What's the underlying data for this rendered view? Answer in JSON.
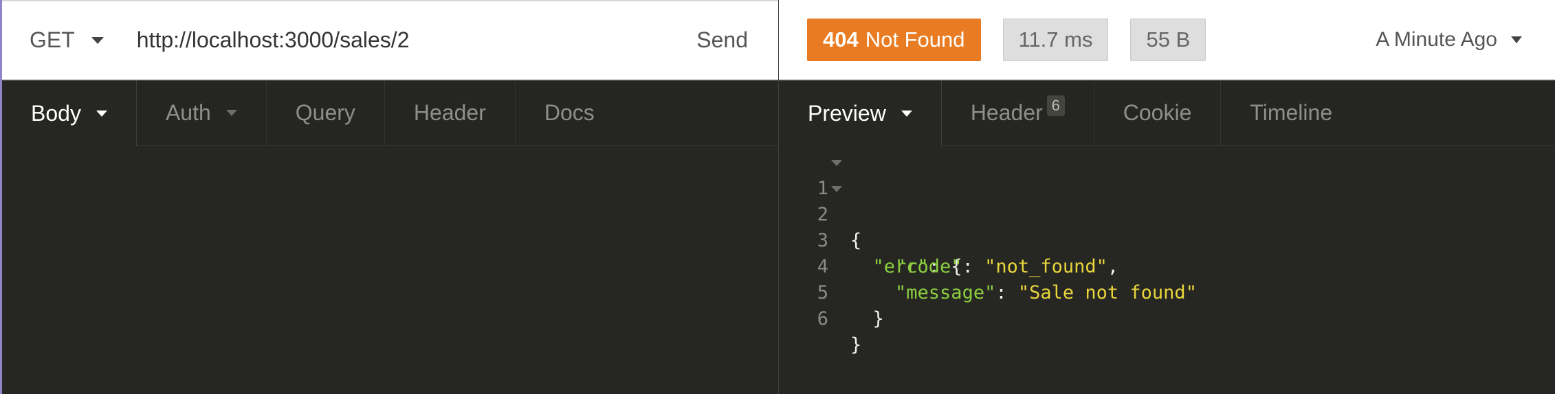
{
  "request": {
    "method": "GET",
    "url": "http://localhost:3000/sales/2",
    "send_label": "Send",
    "tabs": [
      {
        "label": "Body"
      },
      {
        "label": "Auth"
      },
      {
        "label": "Query"
      },
      {
        "label": "Header"
      },
      {
        "label": "Docs"
      }
    ]
  },
  "response": {
    "status_code": "404",
    "status_text": "Not Found",
    "status_color": "#e97c22",
    "time": "11.7 ms",
    "size": "55 B",
    "history_label": "A Minute Ago",
    "tabs": [
      {
        "label": "Preview"
      },
      {
        "label": "Header",
        "count": "6"
      },
      {
        "label": "Cookie"
      },
      {
        "label": "Timeline"
      }
    ],
    "body": {
      "line_numbers": [
        "1",
        "2",
        "3",
        "4",
        "5",
        "6"
      ],
      "open_brace": "{",
      "err_key": "\"err\"",
      "colon": ": ",
      "code_key": "\"code\"",
      "code_value": "\"not_found\"",
      "comma": ",",
      "message_key": "\"message\"",
      "message_value": "\"Sale not found\"",
      "close_brace": "}"
    }
  }
}
